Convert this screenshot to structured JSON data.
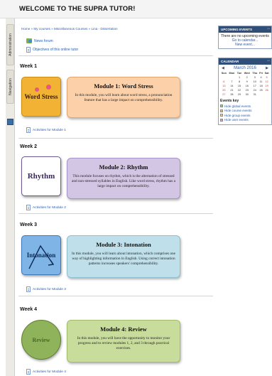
{
  "header": {
    "title": "WELCOME TO THE SUPRA TUTOR!"
  },
  "dock": {
    "admin_label": "Administration",
    "nav_label": "Navigation"
  },
  "breadcrumb": "Home  »  My courses  »  Miscellaneous Courses  »  Lina - Dissertation",
  "top_links": {
    "news": "News forum",
    "objectives": "Objectives of this online tutor"
  },
  "weeks": [
    {
      "label": "Week 1",
      "thumb": "Word Stress",
      "title": "Module 1: Word Stress",
      "desc": "In this module, you will learn about word stress, a pronunciation feature that has a large impact on comprehensibility.",
      "activity": "Activities for Module 1"
    },
    {
      "label": "Week 2",
      "thumb": "Rhythm",
      "title": "Module 2: Rhythm",
      "desc": "This module focuses on rhythm, which is the alternation of stressed and non-stressed syllables in English. Like word stress, rhythm has a large impact on comprehensibility.",
      "activity": "Activities for Module 2"
    },
    {
      "label": "Week 3",
      "thumb": "Intonation",
      "title": "Module 3: Intonation",
      "desc": "In this module, you will learn about intonation, which comprises one way of highlighting information in English. Using correct intonation patterns increases speakers' comprehensibility.",
      "activity": "Activities for Module 3"
    },
    {
      "label": "Week 4",
      "thumb": "Review",
      "title": "Module 4: Review",
      "desc": "In this module, you will have the opportunity to monitor your progress and to review modules 1, 2, and 3 through practical exercises.",
      "activity": "Activities for Module 4"
    }
  ],
  "upcoming": {
    "title": "UPCOMING EVENTS",
    "empty_text": "There are no upcoming events",
    "goto_link": "Go to calendar...",
    "new_event_link": "New event..."
  },
  "calendar": {
    "title": "CALENDAR",
    "month": "March 2016",
    "day_headers": [
      "Sun",
      "Mon",
      "Tue",
      "Wed",
      "Thu",
      "Fri",
      "Sat"
    ],
    "rows": [
      [
        "",
        "",
        "1",
        "2",
        "3",
        "4",
        "5"
      ],
      [
        "6",
        "7",
        "8",
        "9",
        "10",
        "11",
        "12"
      ],
      [
        "13",
        "14",
        "15",
        "16",
        "17",
        "18",
        "19"
      ],
      [
        "20",
        "21",
        "22",
        "23",
        "24",
        "25",
        "26"
      ],
      [
        "27",
        "28",
        "29",
        "30",
        "31",
        "",
        ""
      ]
    ],
    "events_key_title": "Events key",
    "events_key": [
      {
        "label": "Hide global events",
        "color": "#8fd37a"
      },
      {
        "label": "Hide course events",
        "color": "#f4b66a"
      },
      {
        "label": "Hide group events",
        "color": "#f4d46a"
      },
      {
        "label": "Hide user events",
        "color": "#c9a4e0"
      }
    ]
  }
}
